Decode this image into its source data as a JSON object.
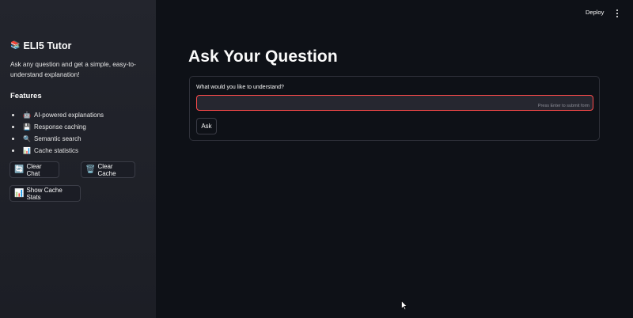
{
  "sidebar": {
    "title": "ELI5 Tutor",
    "title_icon": "books-icon",
    "description": "Ask any question and get a simple, easy-to-understand explanation!",
    "features_heading": "Features",
    "features": [
      {
        "icon": "robot-icon",
        "glyph": "🤖",
        "label": "AI-powered explanations"
      },
      {
        "icon": "floppy-disk-icon",
        "glyph": "💾",
        "label": "Response caching"
      },
      {
        "icon": "magnifier-icon",
        "glyph": "🔍",
        "label": "Semantic search"
      },
      {
        "icon": "bar-chart-icon",
        "glyph": "📊",
        "label": "Cache statistics"
      }
    ],
    "buttons": {
      "clear_chat": {
        "icon": "refresh-icon",
        "glyph": "🔄",
        "label": "Clear Chat"
      },
      "clear_cache": {
        "icon": "trash-icon",
        "glyph": "🗑️",
        "label": "Clear Cache"
      },
      "show_stats": {
        "icon": "bar-chart-icon",
        "glyph": "📊",
        "label": "Show Cache Stats"
      }
    }
  },
  "header": {
    "deploy_label": "Deploy",
    "menu_icon": "kebab-menu-icon"
  },
  "main": {
    "title": "Ask Your Question",
    "form": {
      "label": "What would you like to understand?",
      "input_value": "",
      "hint": "Press Enter to submit form",
      "submit_label": "Ask"
    }
  },
  "colors": {
    "background": "#0e1117",
    "sidebar": "#262730",
    "input_focus_border": "#ff4b4b",
    "text": "#fafafa"
  }
}
